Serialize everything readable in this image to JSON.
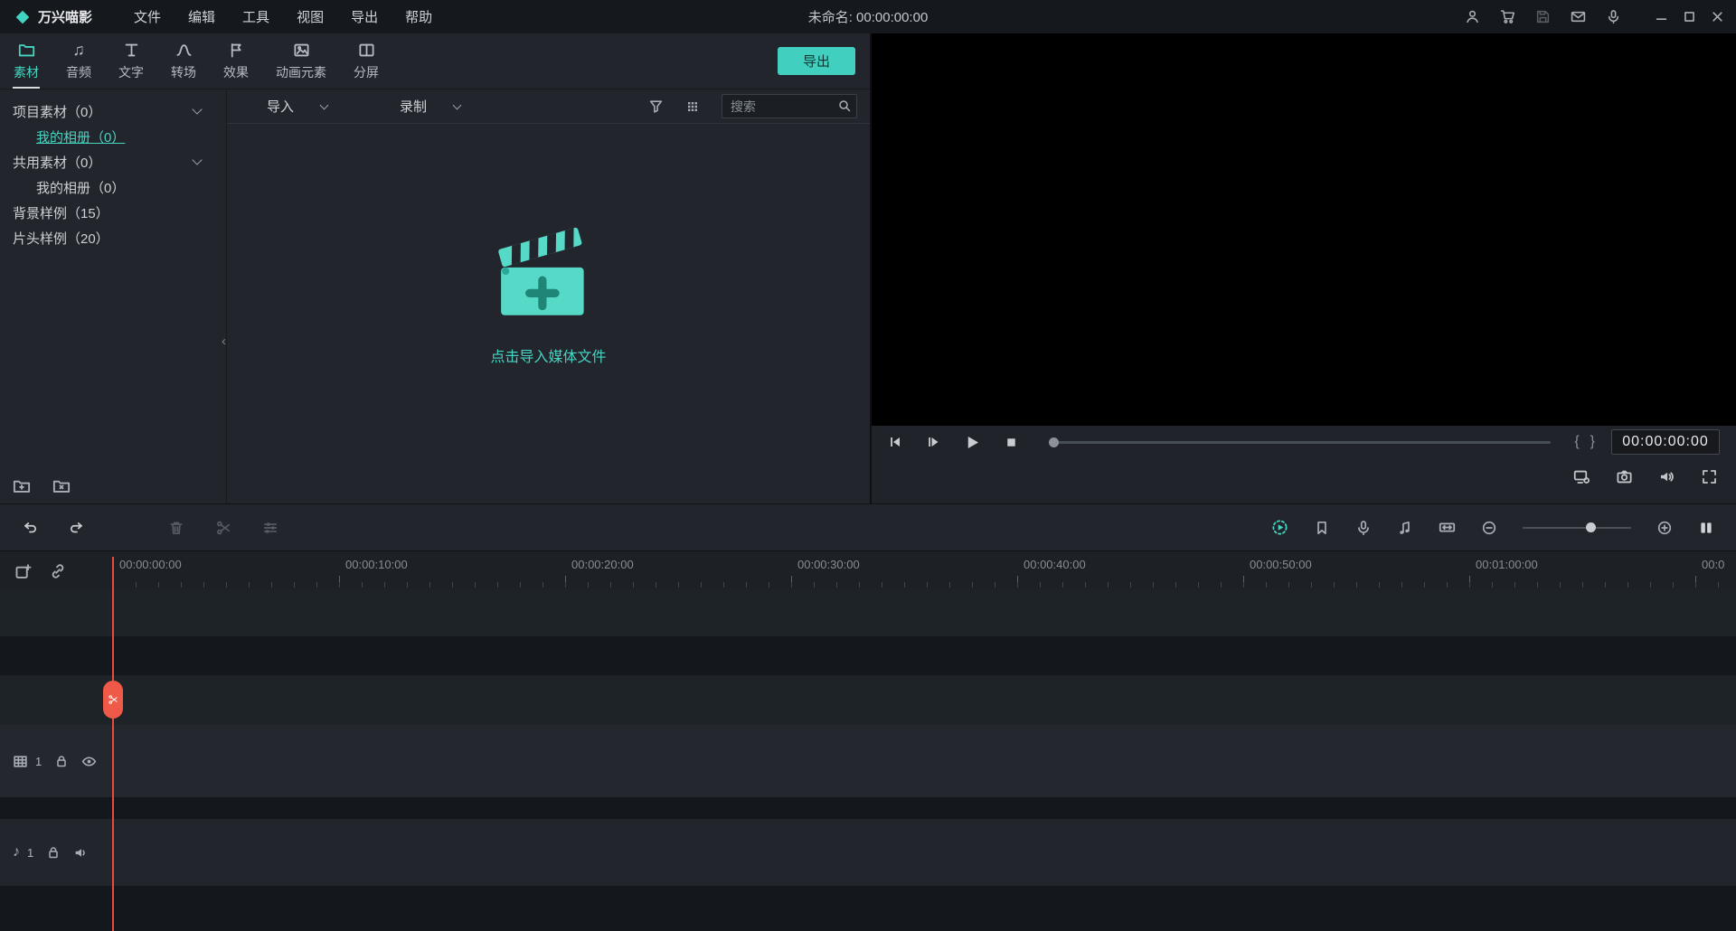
{
  "colors": {
    "accent": "#45d5c3",
    "playhead": "#ef5040",
    "export_bg": "#41d0bf"
  },
  "titlebar": {
    "app_name": "万兴喵影",
    "menus": [
      "文件",
      "编辑",
      "工具",
      "视图",
      "导出",
      "帮助"
    ],
    "project_title": "未命名: 00:00:00:00"
  },
  "ribbon": {
    "tabs": [
      {
        "label": "素材",
        "active": true
      },
      {
        "label": "音频",
        "active": false
      },
      {
        "label": "文字",
        "active": false
      },
      {
        "label": "转场",
        "active": false
      },
      {
        "label": "效果",
        "active": false
      },
      {
        "label": "动画元素",
        "active": false
      },
      {
        "label": "分屏",
        "active": false
      }
    ],
    "export_label": "导出"
  },
  "sidebar": {
    "items": [
      {
        "label": "项目素材（0）",
        "level": 0,
        "expandable": true,
        "selected": false
      },
      {
        "label": "我的相册（0）",
        "level": 1,
        "expandable": false,
        "selected": true
      },
      {
        "label": "共用素材（0）",
        "level": 0,
        "expandable": true,
        "selected": false
      },
      {
        "label": "我的相册（0）",
        "level": 1,
        "expandable": false,
        "selected": false
      },
      {
        "label": "背景样例（15）",
        "level": 0,
        "expandable": false,
        "selected": false
      },
      {
        "label": "片头样例（20）",
        "level": 0,
        "expandable": false,
        "selected": false
      }
    ]
  },
  "library": {
    "import_label": "导入",
    "record_label": "录制",
    "search_placeholder": "搜索",
    "empty_hint": "点击导入媒体文件"
  },
  "preview": {
    "timecode": "00:00:00:00",
    "mark_in": "{",
    "mark_out": "}"
  },
  "timeline": {
    "ruler_labels": [
      "00:00:00:00",
      "00:00:10:00",
      "00:00:20:00",
      "00:00:30:00",
      "00:00:40:00",
      "00:00:50:00",
      "00:01:00:00",
      "00:0"
    ],
    "video_track_label": "1",
    "audio_track_label": "1"
  },
  "icons": {
    "music_note": "♫",
    "audio_note": "♪",
    "collapse": "‹"
  }
}
